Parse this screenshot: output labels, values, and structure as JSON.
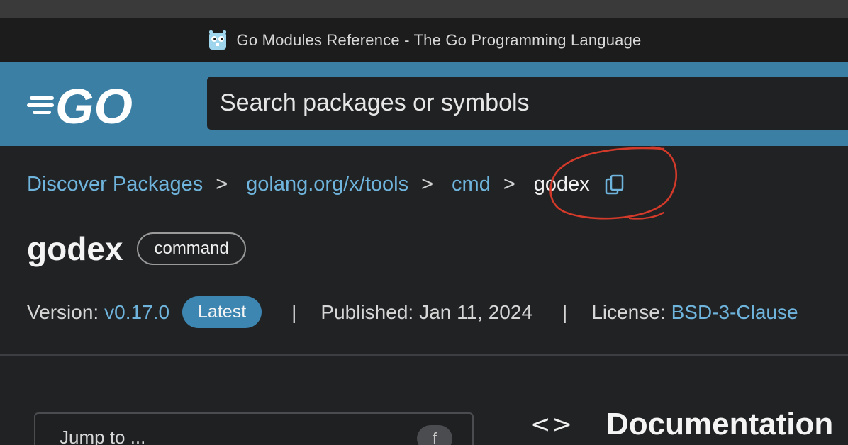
{
  "window": {
    "title": "Go Modules Reference - The Go Programming Language"
  },
  "header": {
    "logo_text": "GO",
    "search_placeholder": "Search packages or symbols"
  },
  "breadcrumb": {
    "items": [
      "Discover Packages",
      "golang.org/x/tools",
      "cmd"
    ],
    "separator": ">",
    "current": "godex"
  },
  "package": {
    "name": "godex",
    "kind_badge": "command"
  },
  "meta": {
    "version_label": "Version:",
    "version": "v0.17.0",
    "latest_badge": "Latest",
    "separator": "|",
    "published_label": "Published:",
    "published_date": "Jan 11, 2024",
    "license_label": "License:",
    "license": "BSD-3-Clause"
  },
  "sidebar": {
    "jump_label": "Jump to ...",
    "jump_shortcut": "f"
  },
  "documentation": {
    "icon": "<>",
    "title": "Documentation"
  },
  "colors": {
    "header_bg": "#3c7fa5",
    "page_bg": "#202224",
    "link": "#6fb4dc",
    "annotation": "#d43a2a"
  },
  "icons": [
    "gopher-favicon",
    "go-logo",
    "copy-icon",
    "code-icon"
  ]
}
